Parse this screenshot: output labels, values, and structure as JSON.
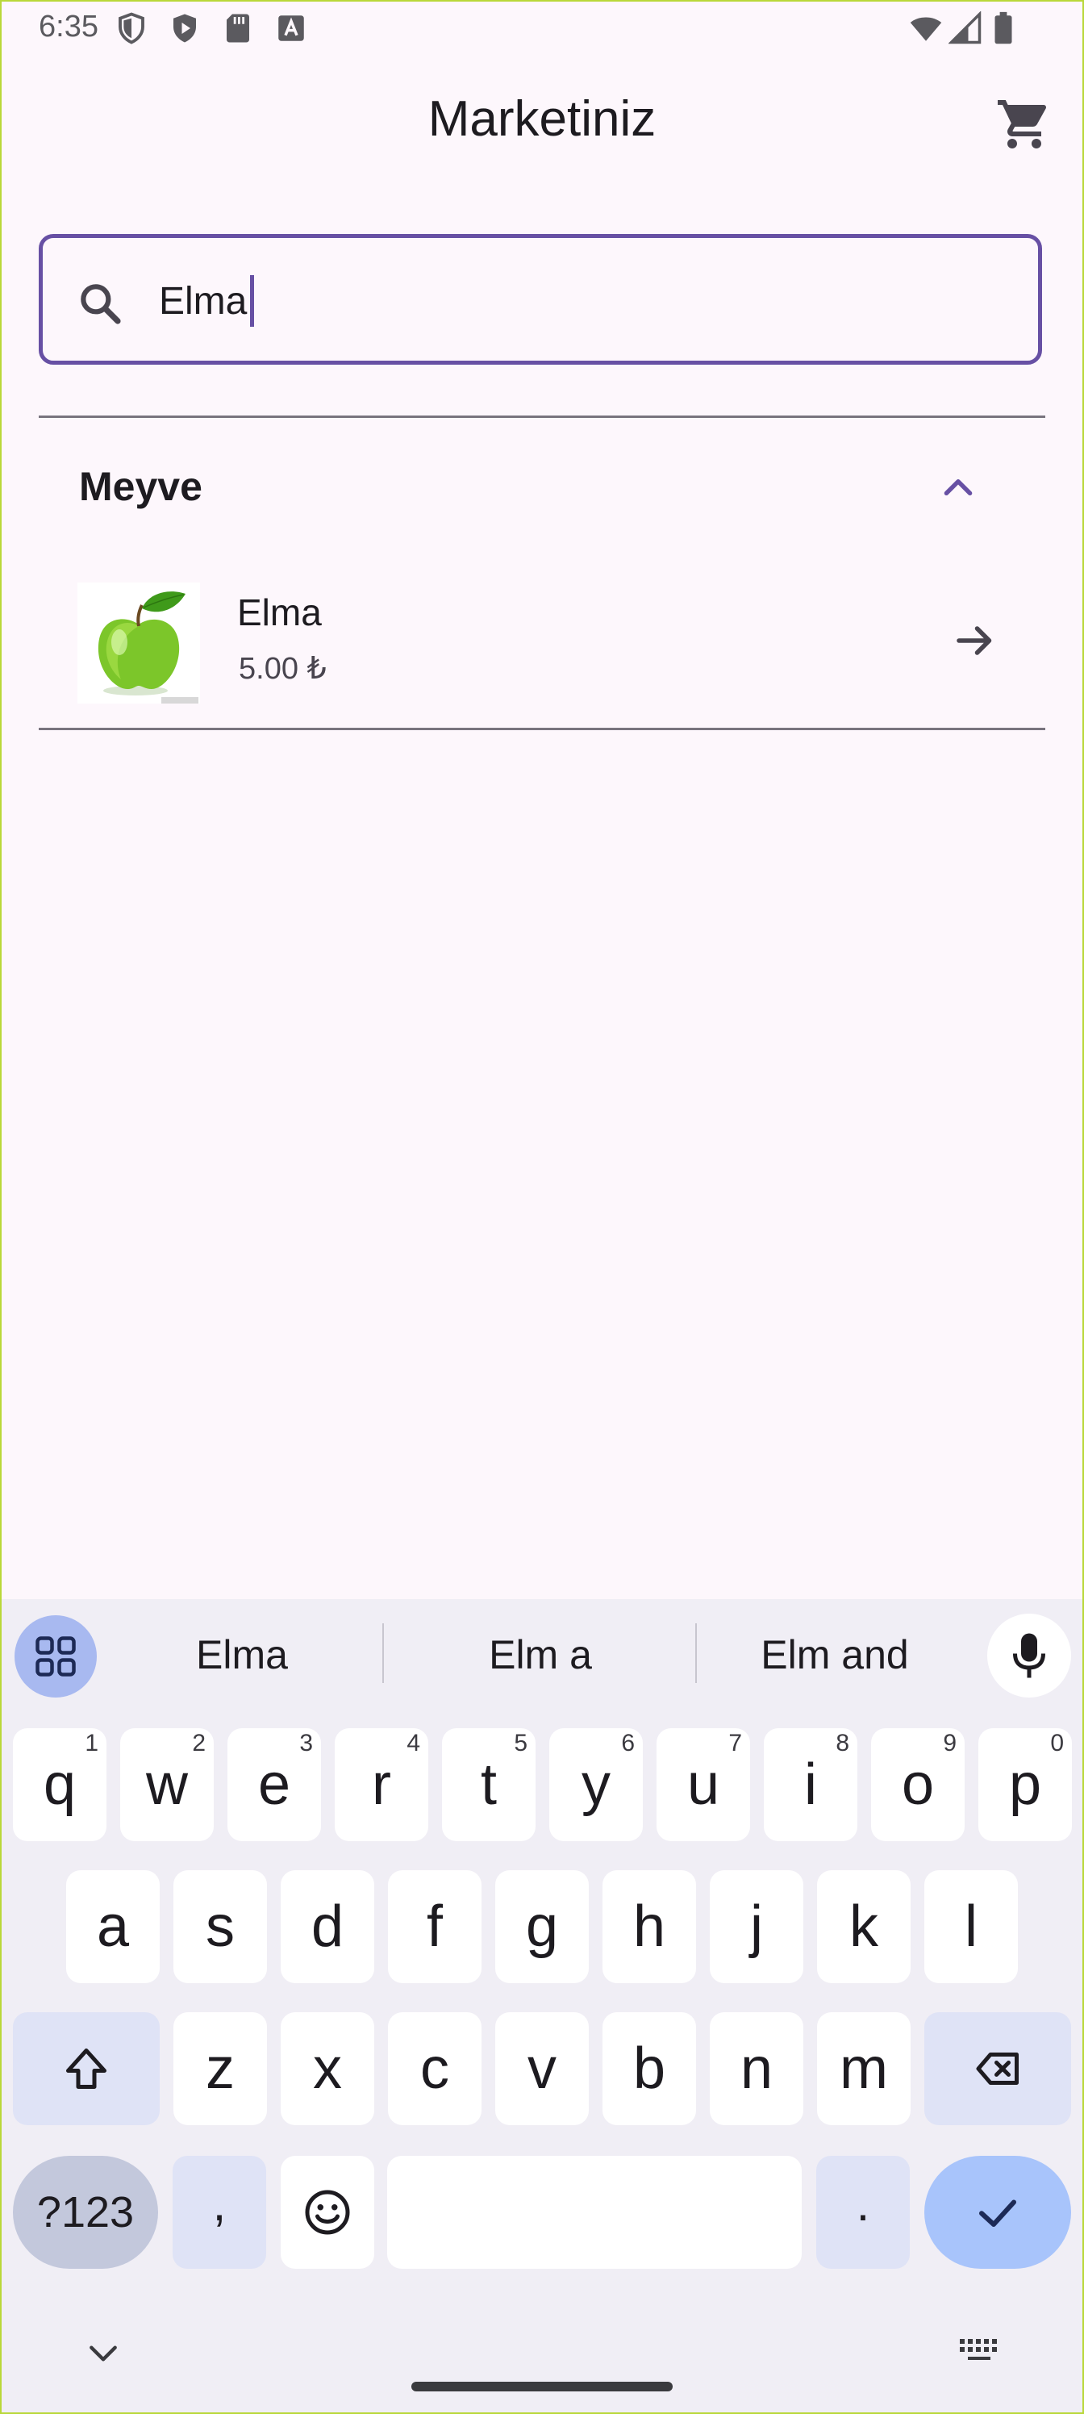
{
  "status_bar": {
    "time": "6:35"
  },
  "app_bar": {
    "title": "Marketiniz"
  },
  "search": {
    "value": "Elma"
  },
  "category": {
    "title": "Meyve",
    "products": [
      {
        "name": "Elma",
        "price": "5.00 ₺"
      }
    ]
  },
  "keyboard": {
    "suggestions": [
      "Elma",
      "Elm a",
      "Elm and"
    ],
    "row1": [
      {
        "key": "q",
        "hint": "1"
      },
      {
        "key": "w",
        "hint": "2"
      },
      {
        "key": "e",
        "hint": "3"
      },
      {
        "key": "r",
        "hint": "4"
      },
      {
        "key": "t",
        "hint": "5"
      },
      {
        "key": "y",
        "hint": "6"
      },
      {
        "key": "u",
        "hint": "7"
      },
      {
        "key": "i",
        "hint": "8"
      },
      {
        "key": "o",
        "hint": "9"
      },
      {
        "key": "p",
        "hint": "0"
      }
    ],
    "row2": [
      "a",
      "s",
      "d",
      "f",
      "g",
      "h",
      "j",
      "k",
      "l"
    ],
    "row3": [
      "z",
      "x",
      "c",
      "v",
      "b",
      "n",
      "m"
    ],
    "symbols_label": "?123",
    "comma_label": ",",
    "period_label": "."
  }
}
